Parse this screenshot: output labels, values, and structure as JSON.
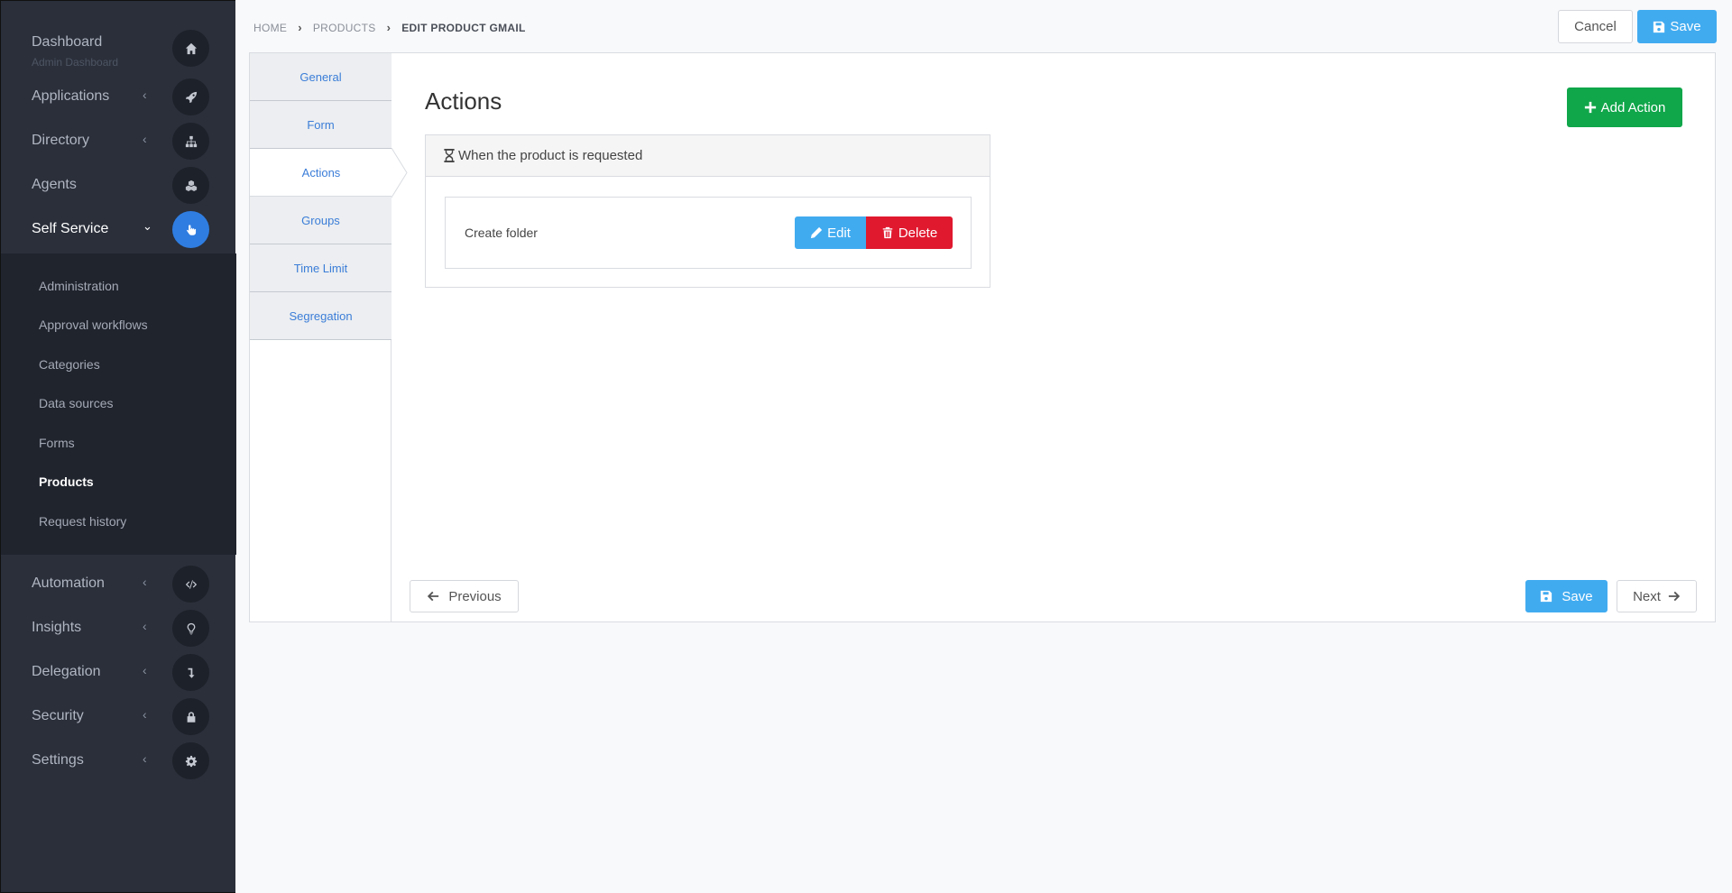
{
  "sidebar": {
    "dashboard": {
      "label": "Dashboard",
      "sub": "Admin Dashboard",
      "icon": "home-icon"
    },
    "applications": {
      "label": "Applications",
      "icon": "rocket-icon"
    },
    "directory": {
      "label": "Directory",
      "icon": "sitemap-icon"
    },
    "agents": {
      "label": "Agents",
      "icon": "cubes-icon"
    },
    "self_service": {
      "label": "Self Service",
      "icon": "hand-pointer-icon"
    },
    "submenu": [
      "Administration",
      "Approval workflows",
      "Categories",
      "Data sources",
      "Forms",
      "Products",
      "Request history"
    ],
    "automation": {
      "label": "Automation",
      "icon": "code-icon"
    },
    "insights": {
      "label": "Insights",
      "icon": "lightbulb-icon"
    },
    "delegation": {
      "label": "Delegation",
      "icon": "level-down-icon"
    },
    "security": {
      "label": "Security",
      "icon": "lock-icon"
    },
    "settings": {
      "label": "Settings",
      "icon": "gear-icon"
    }
  },
  "breadcrumb": {
    "home": "HOME",
    "products": "PRODUCTS",
    "current": "EDIT PRODUCT GMAIL"
  },
  "header": {
    "cancel": "Cancel",
    "save": "Save"
  },
  "tabs": [
    "General",
    "Form",
    "Actions",
    "Groups",
    "Time Limit",
    "Segregation"
  ],
  "main": {
    "title": "Actions",
    "add_action": "Add Action",
    "trigger": "When the product is requested",
    "action_name": "Create folder",
    "edit": "Edit",
    "delete": "Delete"
  },
  "footer": {
    "previous": "Previous",
    "save": "Save",
    "next": "Next"
  },
  "colors": {
    "sidebar": "#2a2f3a",
    "accent_blue": "#41abf0",
    "active_icon": "#2f7de1",
    "green": "#10a64a",
    "red": "#e0192f",
    "tab_link": "#3b7dd8"
  }
}
